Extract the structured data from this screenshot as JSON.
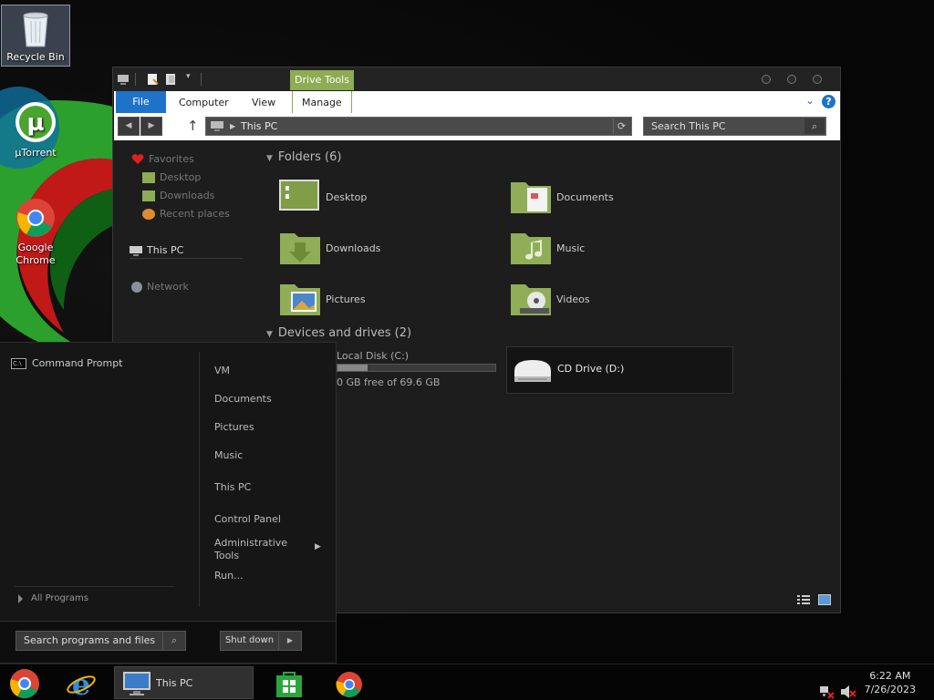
{
  "desktop": {
    "icons": [
      {
        "label": "Recycle Bin",
        "icon": "recycle-bin-icon"
      },
      {
        "label": "µTorrent",
        "icon": "utorrent-icon"
      },
      {
        "label": "Google Chrome",
        "icon": "chrome-icon"
      }
    ]
  },
  "explorer": {
    "context_tab": "Drive Tools",
    "ribbon_tabs": [
      "File",
      "Computer",
      "View",
      "Manage"
    ],
    "address": "This PC",
    "search_placeholder": "Search This PC",
    "nav": {
      "favorites": "Favorites",
      "favorites_items": [
        "Desktop",
        "Downloads",
        "Recent places"
      ],
      "this_pc": "This PC",
      "network": "Network"
    },
    "folders_header": "Folders (6)",
    "folders": [
      "Desktop",
      "Documents",
      "Downloads",
      "Music",
      "Pictures",
      "Videos"
    ],
    "devices_header": "Devices and drives (2)",
    "drives": [
      {
        "name": "Local Disk (C:)",
        "free": "0 GB free of 69.6 GB",
        "used_fraction": 0.19
      },
      {
        "name": "CD Drive (D:)"
      }
    ]
  },
  "start_menu": {
    "pinned": [
      "Command Prompt"
    ],
    "all_programs": "All Programs",
    "right_items": [
      "VM",
      "Documents",
      "Pictures",
      "Music",
      "This PC",
      "Control Panel",
      "Administrative Tools",
      "Run..."
    ],
    "search_placeholder": "Search programs and files",
    "shutdown_label": "Shut down"
  },
  "taskbar": {
    "items": [
      "start-orb",
      "internet-explorer",
      "This PC",
      "store",
      "chrome"
    ],
    "thispc_label": "This PC",
    "clock_time": "6:22 AM",
    "clock_date": "7/26/2023"
  },
  "colors": {
    "accent_green": "#8dac53",
    "file_tab_blue": "#1e73c8",
    "window_bg": "#1d1d1d"
  }
}
